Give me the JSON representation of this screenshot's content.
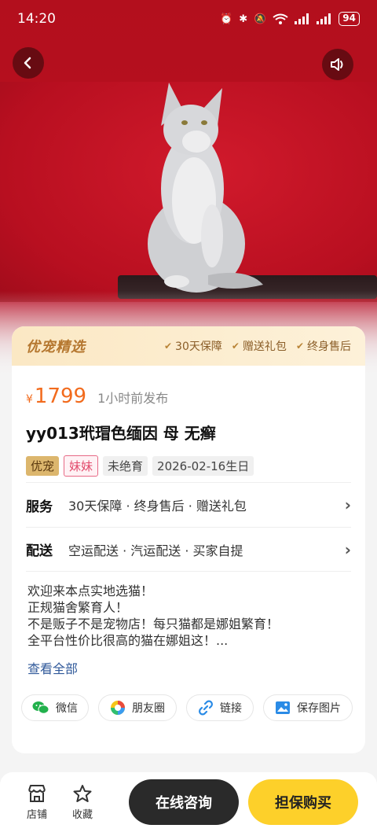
{
  "status_bar": {
    "time": "14:20",
    "battery": "94"
  },
  "hero": {
    "image_alt": "cat-photo"
  },
  "card": {
    "brand": "优宠精选",
    "perks": [
      "30天保障",
      "赠送礼包",
      "终身售后"
    ],
    "currency": "¥",
    "price": "1799",
    "posted": "1小时前发布",
    "title": "yy013玳瑁色缅因 母 无癣",
    "tags": [
      "优宠",
      "妹妹",
      "未绝育",
      "2026-02-16生日"
    ],
    "service_label": "服务",
    "service_value": "30天保障 · 终身售后 · 赠送礼包",
    "delivery_label": "配送",
    "delivery_value": "空运配送 · 汽运配送 · 买家自提",
    "desc_lines": [
      "欢迎来本点实地选猫！",
      "正规猫舍繁育人！",
      "不是贩子不是宠物店！每只猫都是娜姐繁育！",
      "全平台性价比很高的猫在娜姐这！..."
    ],
    "see_all": "查看全部",
    "share": [
      "微信",
      "朋友圈",
      "链接",
      "保存图片"
    ]
  },
  "bottom_bar": {
    "shop": "店铺",
    "favorite": "收藏",
    "consult": "在线咨询",
    "buy": "担保购买"
  },
  "colors": {
    "accent": "#f26b1d",
    "buy": "#fdd02a",
    "consult": "#2a2a2a",
    "brand": "#b5772f"
  }
}
